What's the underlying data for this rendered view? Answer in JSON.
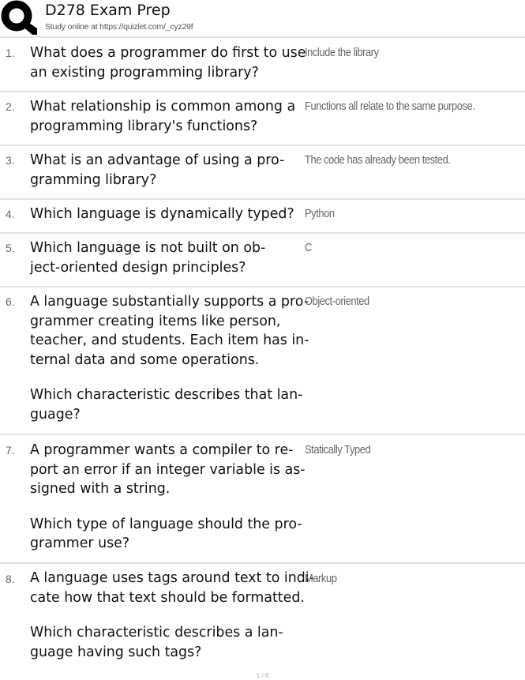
{
  "header": {
    "title": "D278 Exam Prep",
    "subtitle": "Study online at https://quizlet.com/_cyz29f",
    "logo_icon": "quizlet-q-logo"
  },
  "cards": [
    {
      "number": "1.",
      "question_lines": [
        "What does a programmer do first to use",
        "an existing programming library?"
      ],
      "answer": "Include the library"
    },
    {
      "number": "2.",
      "question_lines": [
        "What relationship is common among a",
        "programming library's functions?"
      ],
      "answer": "Functions all relate to the same purpose."
    },
    {
      "number": "3.",
      "question_lines": [
        "What is an advantage of using a pro-",
        "gramming library?"
      ],
      "answer": "The code has already been tested."
    },
    {
      "number": "4.",
      "question_lines": [
        "Which language is dynamically typed?"
      ],
      "answer": "Python"
    },
    {
      "number": "5.",
      "question_lines": [
        "Which language is not built on ob-",
        "ject-oriented design principles?"
      ],
      "answer": "C"
    },
    {
      "number": "6.",
      "question_lines": [
        "A language substantially supports a pro-",
        "grammer creating items like person,",
        "teacher, and students. Each item has in-",
        "ternal data and some operations.",
        "",
        "Which characteristic describes that lan-",
        "guage?"
      ],
      "answer": "Object-oriented"
    },
    {
      "number": "7.",
      "question_lines": [
        "A programmer wants a compiler to re-",
        "port an error if an integer variable is as-",
        "signed with a string.",
        "",
        "Which type of language should the pro-",
        "grammer use?"
      ],
      "answer": "Statically Typed"
    },
    {
      "number": "8.",
      "question_lines": [
        "A language uses tags around text to indi-",
        "cate how that text should be formatted.",
        "",
        "Which characteristic describes a lan-",
        "guage having such tags?"
      ],
      "answer": "Markup"
    }
  ],
  "footer": {
    "page_number": "1 / 6"
  }
}
